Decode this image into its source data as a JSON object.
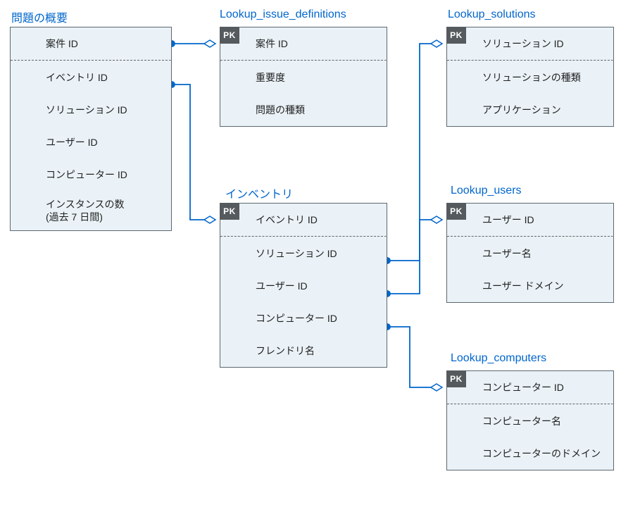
{
  "colors": {
    "title": "#0066cc",
    "border": "#5b6770",
    "fill": "#eaf2f7",
    "wire": "#0066cc",
    "pk_bg": "#555a5e"
  },
  "pk_label": "PK",
  "tables": {
    "issue_summary": {
      "title": "問題の概要",
      "pk_field": "案件 ID",
      "fields": [
        "イベントリ ID",
        "ソリューション ID",
        "ユーザー ID",
        "コンピューター ID",
        "インスタンスの数\n(過去 7 日間)"
      ]
    },
    "lookup_issue_definitions": {
      "title": "Lookup_issue_definitions",
      "pk_field": "案件 ID",
      "fields": [
        "重要度",
        "問題の種類"
      ]
    },
    "lookup_solutions": {
      "title": "Lookup_solutions",
      "pk_field": "ソリューション ID",
      "fields": [
        "ソリューションの種類",
        "アプリケーション"
      ]
    },
    "inventory": {
      "title": "インベントリ",
      "pk_field": "イベントリ ID",
      "fields": [
        "ソリューション ID",
        "ユーザー ID",
        "コンピューター ID",
        "フレンドリ名"
      ]
    },
    "lookup_users": {
      "title": "Lookup_users",
      "pk_field": "ユーザー ID",
      "fields": [
        "ユーザー名",
        "ユーザー ドメイン"
      ]
    },
    "lookup_computers": {
      "title": "Lookup_computers",
      "pk_field": "コンピューター ID",
      "fields": [
        "コンピューター名",
        "コンピューターのドメイン"
      ]
    }
  },
  "relationships": [
    {
      "from": "issue_summary.案件 ID",
      "to": "lookup_issue_definitions.案件 ID"
    },
    {
      "from": "issue_summary.イベントリ ID",
      "to": "inventory.イベントリ ID"
    },
    {
      "from": "inventory.ソリューション ID",
      "to": "lookup_solutions.ソリューション ID"
    },
    {
      "from": "inventory.ユーザー ID",
      "to": "lookup_users.ユーザー ID"
    },
    {
      "from": "inventory.コンピューター ID",
      "to": "lookup_computers.コンピューター ID"
    }
  ]
}
